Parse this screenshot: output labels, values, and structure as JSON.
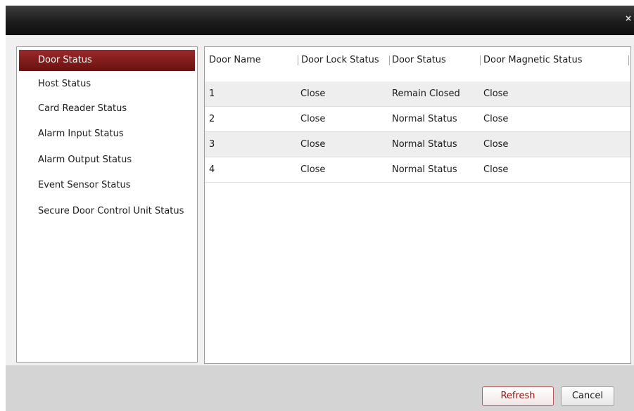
{
  "window": {
    "close_symbol": "×"
  },
  "sidebar": {
    "items": [
      {
        "label": "Door Status",
        "active": true
      },
      {
        "label": "Host Status",
        "active": false
      },
      {
        "label": "Card Reader Status",
        "active": false
      },
      {
        "label": "Alarm Input Status",
        "active": false
      },
      {
        "label": "Alarm Output Status",
        "active": false
      },
      {
        "label": "Event Sensor Status",
        "active": false
      },
      {
        "label": "Secure Door Control Unit Status",
        "active": false
      }
    ]
  },
  "table": {
    "columns": [
      "Door Name",
      "Door Lock Status",
      "Door Status",
      "Door Magnetic Status"
    ],
    "rows": [
      [
        "1",
        "Close",
        "Remain Closed",
        "Close"
      ],
      [
        "2",
        "Close",
        "Normal Status",
        "Close"
      ],
      [
        "3",
        "Close",
        "Normal Status",
        "Close"
      ],
      [
        "4",
        "Close",
        "Normal Status",
        "Close"
      ]
    ]
  },
  "footer": {
    "refresh_label": "Refresh",
    "cancel_label": "Cancel"
  },
  "colors": {
    "title_bar": "#1c1c1c",
    "selected_item": "#7a1a1a",
    "refresh_border": "#b85a5a",
    "refresh_text": "#8e1414"
  }
}
